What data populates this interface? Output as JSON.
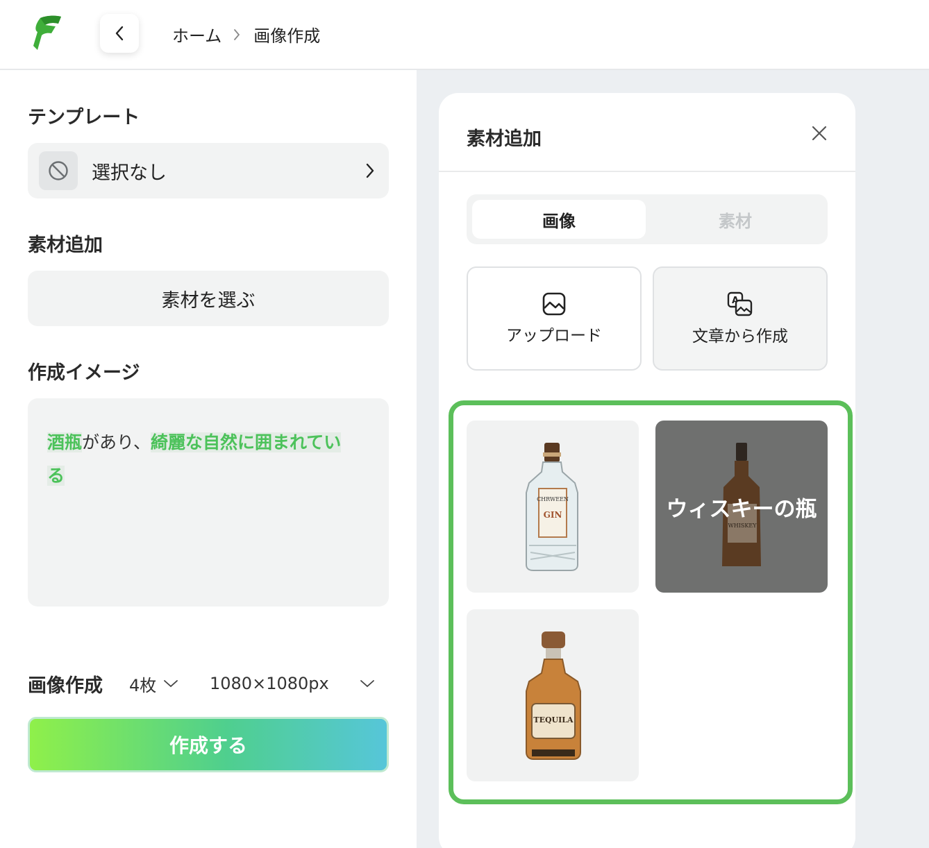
{
  "header": {
    "breadcrumb": [
      "ホーム",
      "画像作成"
    ]
  },
  "left": {
    "template_title": "テンプレート",
    "template_value": "選択なし",
    "material_title": "素材追加",
    "choose_material_label": "素材を選ぶ",
    "image_title": "作成イメージ",
    "prompt": {
      "hl1": "酒瓶",
      "plain1": "があり、",
      "hl2": "綺麗な自然に囲まれてい",
      "hl3": "る"
    },
    "generate_label": "画像作成",
    "count": "4枚",
    "size": "1080×1080px",
    "create_button": "作成する"
  },
  "modal": {
    "title": "素材追加",
    "tabs": {
      "active": "画像",
      "inactive": "素材"
    },
    "actions": {
      "upload": "アップロード",
      "text_to_image": "文章から作成"
    },
    "results": [
      {
        "bottle_label": "GIN",
        "brand": "CHRWEEN"
      },
      {
        "overlay": "ウィスキーの瓶",
        "bottle_label": "WHISKEY"
      },
      {
        "bottle_label": "TEQUILA"
      }
    ]
  },
  "colors": {
    "accent_green": "#5cbf5a",
    "highlight_green": "#4cc25a",
    "gradient_start": "#8ff04a",
    "gradient_end": "#56c6d9"
  }
}
